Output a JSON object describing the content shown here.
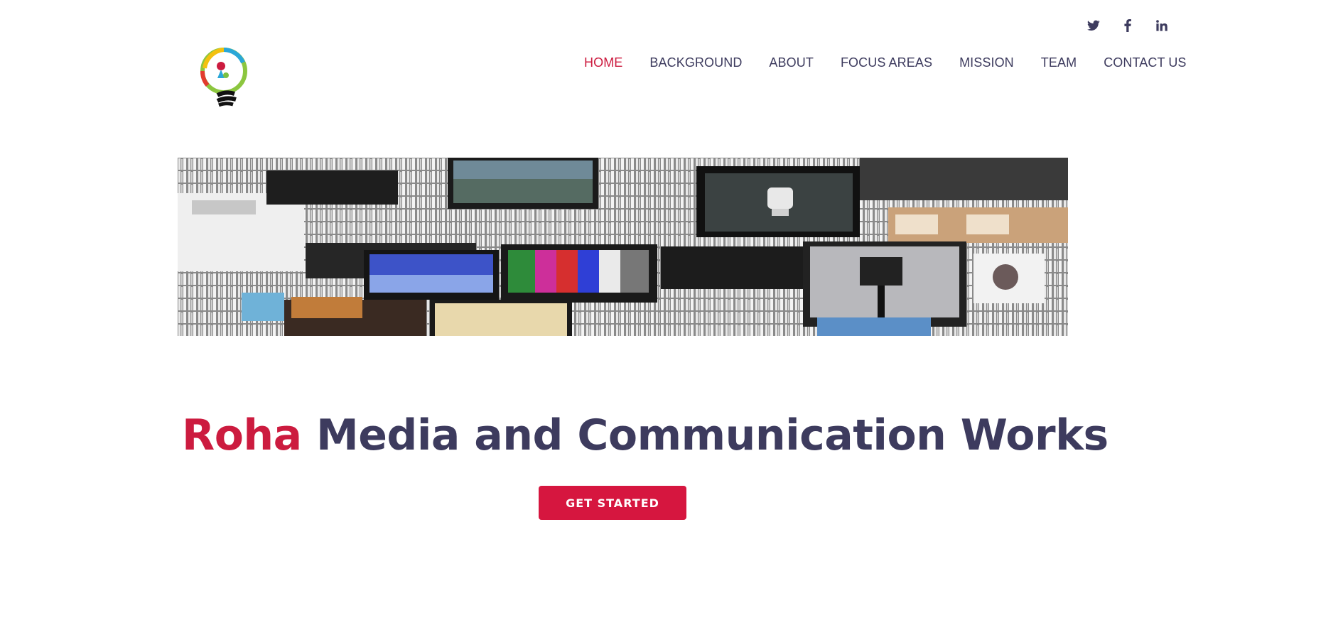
{
  "social": [
    {
      "name": "twitter-icon",
      "label": "Twitter"
    },
    {
      "name": "facebook-icon",
      "label": "Facebook"
    },
    {
      "name": "linkedin-icon",
      "label": "LinkedIn"
    }
  ],
  "nav": {
    "items": [
      "HOME",
      "BACKGROUND",
      "ABOUT",
      "FOCUS AREAS",
      "MISSION",
      "TEAM",
      "CONTACT US"
    ],
    "active": "HOME"
  },
  "hero": {
    "title_accent": "Roha",
    "title_rest": "Media and Communication Works",
    "cta_label": "GET STARTED"
  },
  "colors": {
    "accent": "#cc1b3f",
    "text": "#3d3b5e",
    "button": "#d6163f"
  }
}
